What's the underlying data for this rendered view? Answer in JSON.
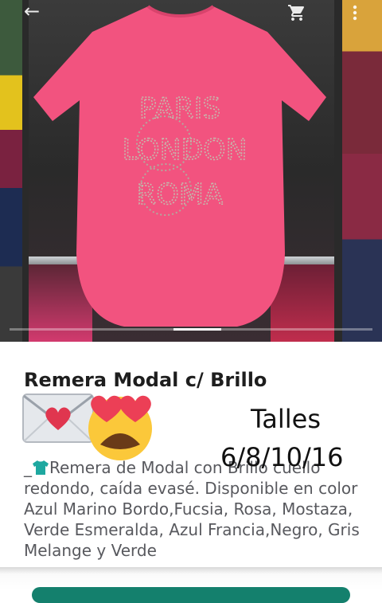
{
  "product": {
    "title": "Remera Modal c/ Brillo",
    "description_prefix": "_",
    "description": "Remera de Modal con Brillo cuello redondo, caída evasé. Disponible en color Azul Marino Bordo,Fucsia, Rosa, Mostaza, Verde Esmeralda, Azul Francia,Negro, Gris Melange y Verde",
    "shirt_print_lines": [
      "PARIS",
      "LONDON",
      "ROMA"
    ],
    "shirt_color": "#f2537f"
  },
  "overlay": {
    "talles_label": "Talles",
    "talles_sizes": "6/8/10/16"
  },
  "gallery": {
    "total_images": 3,
    "current_index": 1
  },
  "icons": {
    "back": "arrow-back-icon",
    "cart": "shopping-cart-icon",
    "more": "more-vert-icon",
    "envelope": "love-letter-emoji",
    "face": "heart-eyes-emoji",
    "tshirt": "t-shirt-emoji"
  },
  "colors": {
    "accent_button": "#14806d",
    "title_text": "#1e1e1e",
    "body_text": "#58595e"
  }
}
